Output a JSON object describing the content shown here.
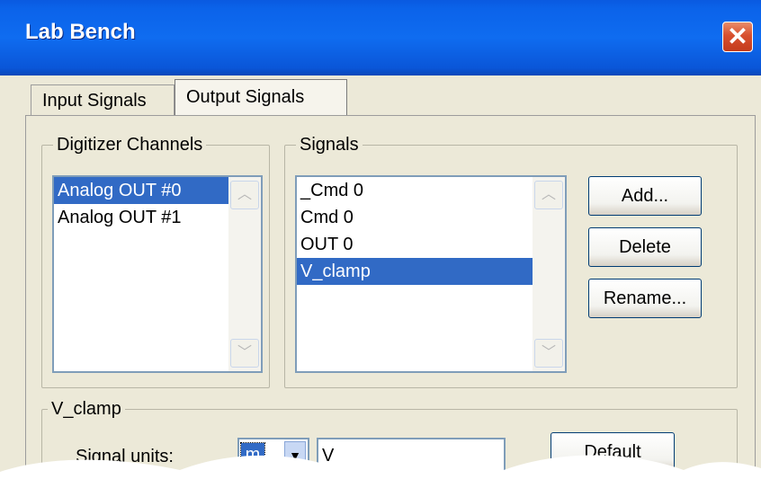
{
  "window": {
    "title": "Lab Bench",
    "close_glyph": "✕"
  },
  "tabs": [
    {
      "label": "Input Signals",
      "active": false
    },
    {
      "label": "Output Signals",
      "active": true
    }
  ],
  "digitizer": {
    "legend": "Digitizer Channels",
    "items": [
      "Analog OUT #0",
      "Analog OUT #1"
    ],
    "selected_index": 0
  },
  "signals": {
    "legend": "Signals",
    "items": [
      "_Cmd 0",
      "Cmd 0",
      "OUT 0",
      "V_clamp"
    ],
    "selected_index": 3,
    "buttons": {
      "add": "Add...",
      "delete": "Delete",
      "rename": "Rename..."
    }
  },
  "signal_group": {
    "legend": "V_clamp",
    "units_label": "Signal units:",
    "prefix_value": "m",
    "unit_value": "V",
    "default_button": "Default"
  },
  "colors": {
    "titlebar": "#0b63ea",
    "selection": "#316ac5",
    "close": "#d8502e"
  },
  "icons": {
    "scroll_up": "chevron-up-icon",
    "scroll_down": "chevron-down-icon",
    "dropdown": "dropdown-arrow-icon"
  }
}
